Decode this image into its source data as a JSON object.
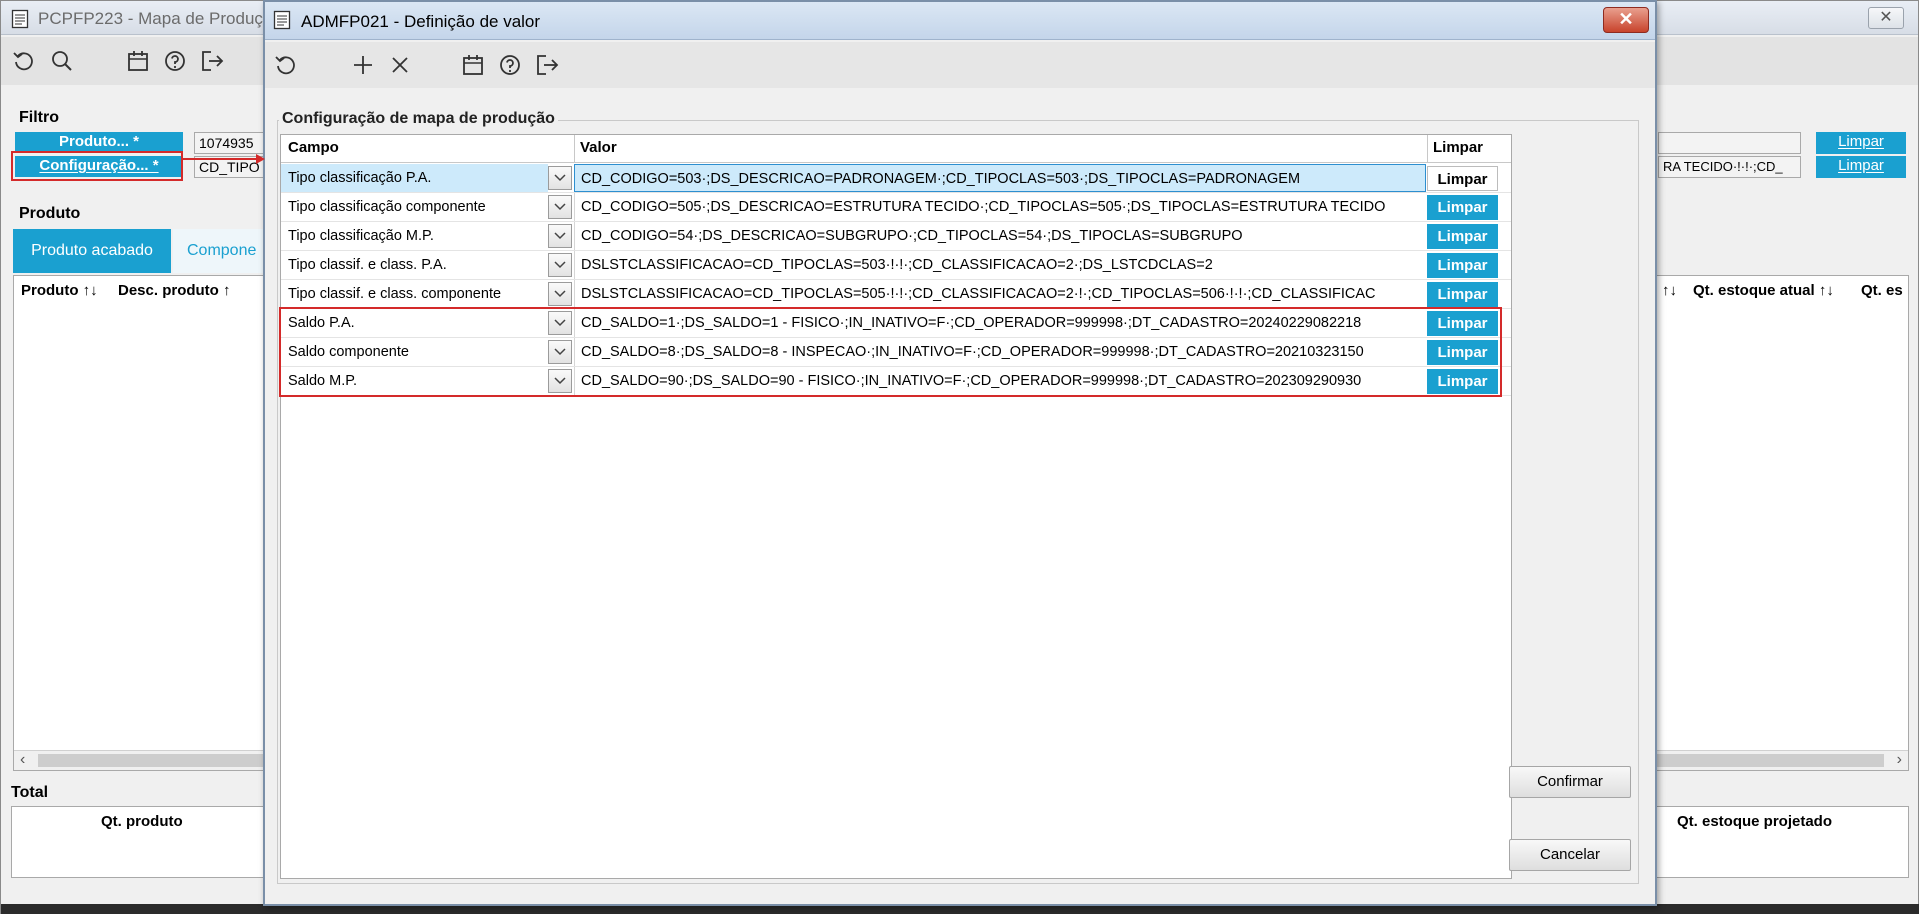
{
  "bg_window": {
    "title": "PCPFP223 - Mapa de Produç",
    "close_glyph": "✕",
    "filtro_label": "Filtro",
    "produto_button": "Produto... *",
    "produto_value": "1074935",
    "configuracao_button": "Configuração... *",
    "configuracao_value": "CD_TIPO",
    "configuracao_value_right": "RA TECIDO·!·!·;CD_",
    "limpar_1": "Limpar",
    "limpar_2": "Limpar",
    "produto_section": "Produto",
    "tabs": [
      "Produto acabado",
      "Compone"
    ],
    "grid_headers": {
      "produto": "Produto ↑↓",
      "desc_produto": "Desc. produto ↑",
      "sort_right": "↑↓",
      "qt_estoque_atual": "Qt. estoque atual ↑↓",
      "qt_es": "Qt. es"
    },
    "total_section": "Total",
    "total_headers": {
      "qt_produto": "Qt. produto",
      "qt_estoque_projetado": "Qt. estoque projetado"
    }
  },
  "dialog": {
    "title": "ADMFP021 - Definição de valor",
    "close_glyph": "✕",
    "group_title": "Configuração de mapa de produção",
    "columns": {
      "campo": "Campo",
      "valor": "Valor",
      "limpar": "Limpar"
    },
    "rows": [
      {
        "campo": "Tipo classificação P.A.",
        "valor": "CD_CODIGO=503·;DS_DESCRICAO=PADRONAGEM·;CD_TIPOCLAS=503·;DS_TIPOCLAS=PADRONAGEM",
        "limpar": "Limpar"
      },
      {
        "campo": "Tipo classificação componente",
        "valor": "CD_CODIGO=505·;DS_DESCRICAO=ESTRUTURA TECIDO·;CD_TIPOCLAS=505·;DS_TIPOCLAS=ESTRUTURA TECIDO",
        "limpar": "Limpar"
      },
      {
        "campo": "Tipo classificação M.P.",
        "valor": "CD_CODIGO=54·;DS_DESCRICAO=SUBGRUPO·;CD_TIPOCLAS=54·;DS_TIPOCLAS=SUBGRUPO",
        "limpar": "Limpar"
      },
      {
        "campo": "Tipo classif. e class. P.A.",
        "valor": "DSLSTCLASSIFICACAO=CD_TIPOCLAS=503·!·!·;CD_CLASSIFICACAO=2·;DS_LSTCDCLAS=2",
        "limpar": "Limpar"
      },
      {
        "campo": "Tipo classif. e class. componente",
        "valor": "DSLSTCLASSIFICACAO=CD_TIPOCLAS=505·!·!·;CD_CLASSIFICACAO=2·!·;CD_TIPOCLAS=506·!·!·;CD_CLASSIFICAC",
        "limpar": "Limpar"
      },
      {
        "campo": "Saldo P.A.",
        "valor": "CD_SALDO=1·;DS_SALDO=1 - FISICO·;IN_INATIVO=F·;CD_OPERADOR=999998·;DT_CADASTRO=20240229082218",
        "limpar": "Limpar"
      },
      {
        "campo": "Saldo componente",
        "valor": "CD_SALDO=8·;DS_SALDO=8 - INSPECAO·;IN_INATIVO=F·;CD_OPERADOR=999998·;DT_CADASTRO=20210323150",
        "limpar": "Limpar"
      },
      {
        "campo": "Saldo M.P.",
        "valor": "CD_SALDO=90·;DS_SALDO=90 - FISICO·;IN_INATIVO=F·;CD_OPERADOR=999998·;DT_CADASTRO=202309290930",
        "limpar": "Limpar"
      }
    ],
    "confirmar": "Confirmar",
    "cancelar": "Cancelar"
  },
  "colors": {
    "accent": "#1aa0d0",
    "highlight_frame": "#d42a2a",
    "selected_row": "#cdeafb"
  }
}
